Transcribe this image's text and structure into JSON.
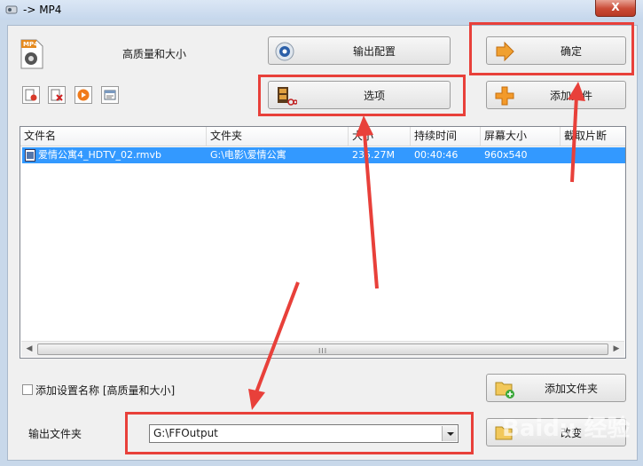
{
  "window": {
    "title": "-> MP4",
    "close_label": "X"
  },
  "preset": {
    "icon_text": "MP4",
    "label": "高质量和大小"
  },
  "buttons": {
    "output_config": "输出配置",
    "ok": "确定",
    "options": "选项",
    "add_file": "添加文件",
    "add_folder": "添加文件夹",
    "cancel": "改变"
  },
  "list": {
    "columns": [
      "文件名",
      "文件夹",
      "大小",
      "持续时间",
      "屏幕大小",
      "截取片断"
    ],
    "rows": [
      {
        "name": "爱情公寓4_HDTV_02.rmvb",
        "folder": "G:\\电影\\爱情公寓",
        "size": "235.27M",
        "duration": "00:40:46",
        "screen": "960x540",
        "clip": ""
      }
    ],
    "scroll_grip": "III"
  },
  "options_row": {
    "checkbox_label": "添加设置名称 [高质量和大小]",
    "output_folder_label": "输出文件夹",
    "output_folder_value": "G:\\FFOutput"
  },
  "watermark": "Baidu 经验",
  "colors": {
    "annotation": "#e8403a",
    "selection": "#3399ff"
  }
}
